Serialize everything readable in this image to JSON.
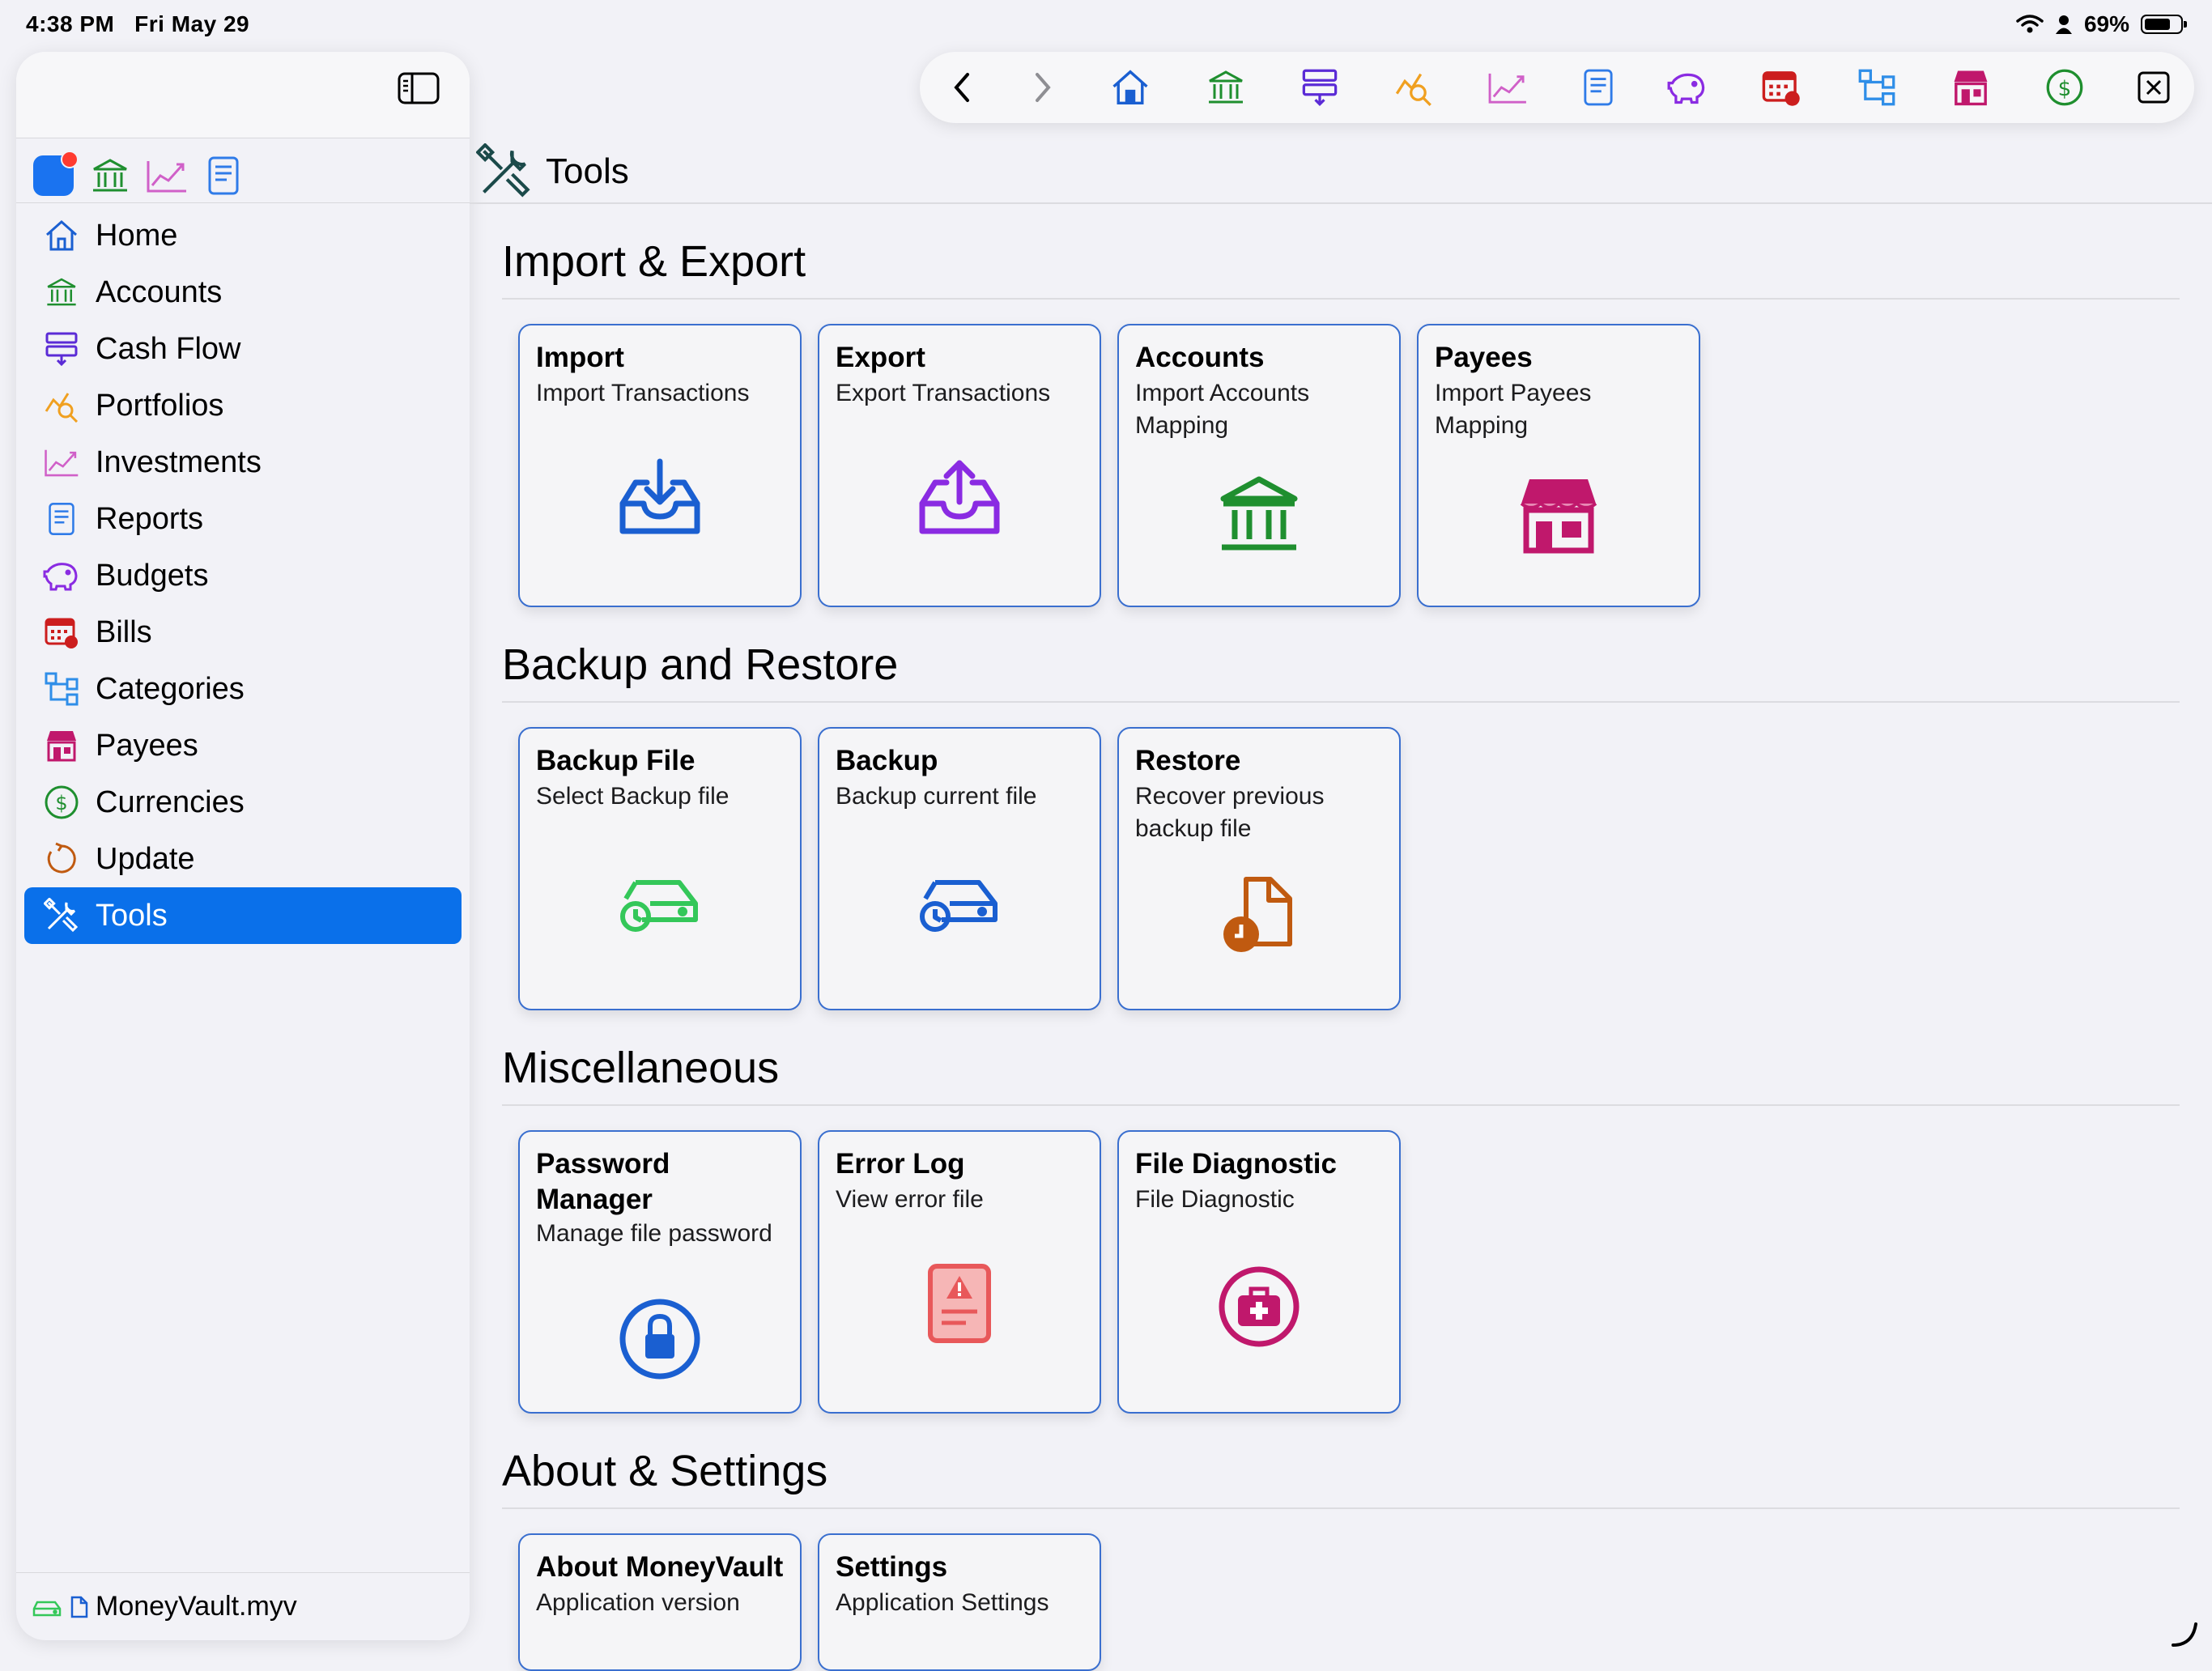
{
  "status_bar": {
    "time": "4:38 PM",
    "date": "Fri May 29",
    "battery": "69%"
  },
  "header": {
    "title": "Tools"
  },
  "sidebar": {
    "items": [
      {
        "label": "Home",
        "icon": "home-icon",
        "color": "#1a5fd1"
      },
      {
        "label": "Accounts",
        "icon": "bank-icon",
        "color": "#1f8f2f"
      },
      {
        "label": "Cash Flow",
        "icon": "cash-flow-icon",
        "color": "#5b2bd6"
      },
      {
        "label": "Portfolios",
        "icon": "portfolio-icon",
        "color": "#f0a020"
      },
      {
        "label": "Investments",
        "icon": "investments-chart-icon",
        "color": "#d060c8"
      },
      {
        "label": "Reports",
        "icon": "report-icon",
        "color": "#2f7be8"
      },
      {
        "label": "Budgets",
        "icon": "piggy-bank-icon",
        "color": "#8a2be2"
      },
      {
        "label": "Bills",
        "icon": "calendar-bill-icon",
        "color": "#cc1e1e"
      },
      {
        "label": "Categories",
        "icon": "categories-icon",
        "color": "#2f8ee8"
      },
      {
        "label": "Payees",
        "icon": "store-icon",
        "color": "#c0186c"
      },
      {
        "label": "Currencies",
        "icon": "dollar-circle-icon",
        "color": "#1f8f2f"
      },
      {
        "label": "Update",
        "icon": "refresh-icon",
        "color": "#c05a10"
      },
      {
        "label": "Tools",
        "icon": "tools-icon",
        "color": "#ffffff"
      }
    ],
    "active": "Tools",
    "footer_file": "MoneyVault.myv"
  },
  "sections": {
    "import_export": {
      "title": "Import & Export",
      "cards": [
        {
          "title": "Import",
          "subtitle": "Import Transactions",
          "icon": "inbox-download-icon",
          "color": "#1a5fd1"
        },
        {
          "title": "Export",
          "subtitle": "Export Transactions",
          "icon": "inbox-upload-icon",
          "color": "#8a2be2"
        },
        {
          "title": "Accounts",
          "subtitle": "Import Accounts Mapping",
          "icon": "bank-icon",
          "color": "#1f8f2f"
        },
        {
          "title": "Payees",
          "subtitle": "Import Payees Mapping",
          "icon": "store-icon",
          "color": "#c0186c"
        }
      ]
    },
    "backup_restore": {
      "title": "Backup and Restore",
      "cards": [
        {
          "title": "Backup File",
          "subtitle": "Select Backup file",
          "icon": "drive-history-icon",
          "color": "#34c759"
        },
        {
          "title": "Backup",
          "subtitle": "Backup current file",
          "icon": "drive-history-icon",
          "color": "#1a5fd1"
        },
        {
          "title": "Restore",
          "subtitle": "Recover previous backup file",
          "icon": "document-clock-icon",
          "color": "#c05a10"
        }
      ]
    },
    "misc": {
      "title": "Miscellaneous",
      "cards": [
        {
          "title": "Password Manager",
          "subtitle": "Manage file password",
          "icon": "lock-circle-icon",
          "color": "#1a5fd1"
        },
        {
          "title": "Error Log",
          "subtitle": "View error file",
          "icon": "error-document-icon",
          "color": "#e8585a"
        },
        {
          "title": "File Diagnostic",
          "subtitle": "File Diagnostic",
          "icon": "medkit-circle-icon",
          "color": "#c0186c"
        }
      ]
    },
    "about": {
      "title": "About & Settings",
      "cards": [
        {
          "title": "About MoneyVault",
          "subtitle": "Application version"
        },
        {
          "title": "Settings",
          "subtitle": "Application Settings"
        }
      ]
    }
  }
}
